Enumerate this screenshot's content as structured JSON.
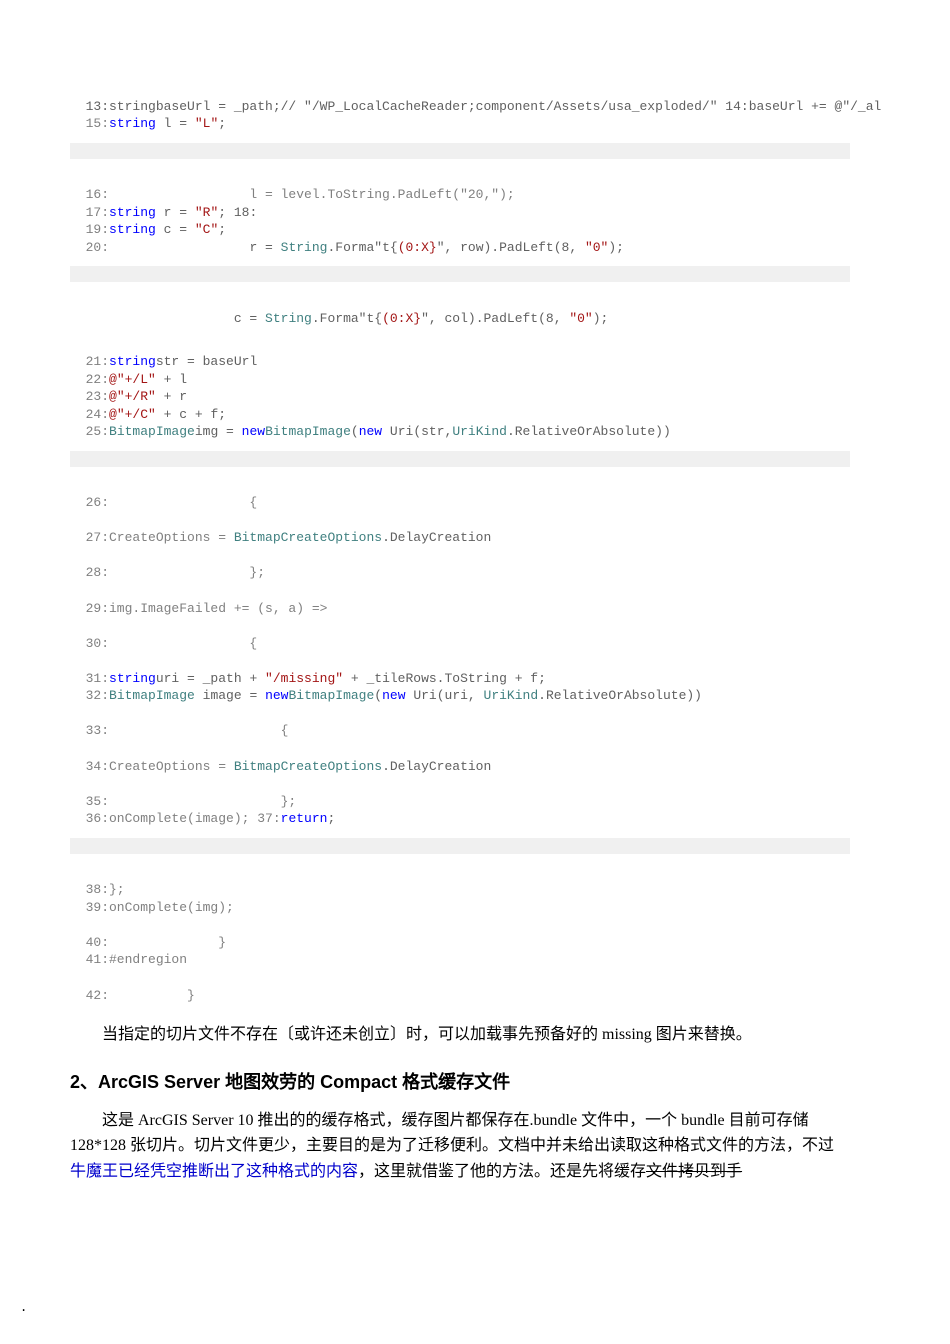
{
  "code": {
    "l13": "  13:stringbaseUrl = _path;// \"/WP_LocalCacheReader;component/Assets/usa_exploded/\" 14:baseUrl += @\"/_al",
    "l15a": "  15:",
    "l15b": "string",
    "l15c": " l = ",
    "l15d": "\"L\"",
    "l15e": ";",
    "l16": "  16:                  l = level.ToString.PadLeft(\"20,\");",
    "l17a": "  17:",
    "l17b": "string",
    "l17c": " r = ",
    "l17d": "\"R\"",
    "l17e": "; 18:",
    "l19a": "  19:",
    "l19b": "string",
    "l19c": " c = ",
    "l19d": "\"C\"",
    "l19e": ";",
    "l20a": "  20:",
    "l20b": "                  r = ",
    "l20c": "String",
    "l20d": ".Forma\"t{",
    "l20e": "(0:X}",
    "l20f": "\", row).PadLeft(8, ",
    "l20g": "\"0\"",
    "l20h": ");",
    "l20bb": "                     c = ",
    "l20cc": "String",
    "l20dd": ".Forma\"t{",
    "l20ee": "(0:X}",
    "l20ff": "\", col).PadLeft(8, ",
    "l20gg": "\"0\"",
    "l20hh": ");",
    "l21a": "  21:",
    "l21b": "string",
    "l21c": "str = baseUrl",
    "l22a": "  22:",
    "l22b": "@\"",
    "l22c": "+/L\"",
    "l22d": " + l",
    "l23a": "  23:",
    "l23b": "@\"",
    "l23c": "+/R\"",
    "l23d": " + r",
    "l24a": "  24:",
    "l24b": "@\"",
    "l24c": "+/C\"",
    "l24d": " + c + f;",
    "l25a": "  25:",
    "l25b": "BitmapImage",
    "l25c": "img = ",
    "l25d": "new",
    "l25e": "BitmapImage",
    "l25f": "(",
    "l25g": "new",
    "l25h": " Uri(str,",
    "l25i": "UriKind",
    "l25j": ".RelativeOrAbsolute))",
    "l26": "  26:                  {",
    "l27a": "  27:CreateOptions = ",
    "l27b": "BitmapCreateOptions",
    "l27c": ".DelayCreation",
    "l28": "  28:                  };",
    "l29": "  29:img.ImageFailed += (s, a) =>",
    "l30": "  30:                  {",
    "l31a": "  31:",
    "l31b": "string",
    "l31c": "uri = _path + ",
    "l31d": "\"/missing\"",
    "l31e": " + _tileRows.ToString + f;",
    "l32a": "  32:",
    "l32b": "BitmapImage",
    "l32c": " image = ",
    "l32d": "new",
    "l32e": "BitmapImage",
    "l32f": "(",
    "l32g": "new",
    "l32h": " Uri(uri, ",
    "l32i": "UriKind",
    "l32j": ".RelativeOrAbsolute))",
    "l33": "  33:                      {",
    "l34a": "  34:CreateOptions = ",
    "l34b": "BitmapCreateOptions",
    "l34c": ".DelayCreation",
    "l35": "  35:                      };",
    "l36a": "  36:onComplete(image); 37:",
    "l36b": "return",
    "l36c": ";",
    "l38": "  38:};",
    "l39": "  39:onComplete(img);",
    "l40": "  40:              }",
    "l41": "  41:#endregion",
    "l42": "  42:          }"
  },
  "para1": "当指定的切片文件不存在〔或许还未创立〕时，可以加载事先预备好的 missing 图片来替换。",
  "heading": "2、ArcGIS Server 地图效劳的 Compact 格式缓存文件",
  "para2a": "这是 ArcGIS  Server  10 推出的的缓存格式，缓存图片都保存在.bundle 文件中，一个 bundle 目前可存储 128*128 张切片。切片文件更少，主要目的是为了迁移便利。文档中并未给出读取这种格式文件的方法，不过",
  "para2link": "牛魔王已经凭空推断出了这种格式的内容",
  "para2b": "，这里就借鉴了他的方法。还是先将缓存",
  "para2strike": "文件拷贝到手",
  "dot": "."
}
